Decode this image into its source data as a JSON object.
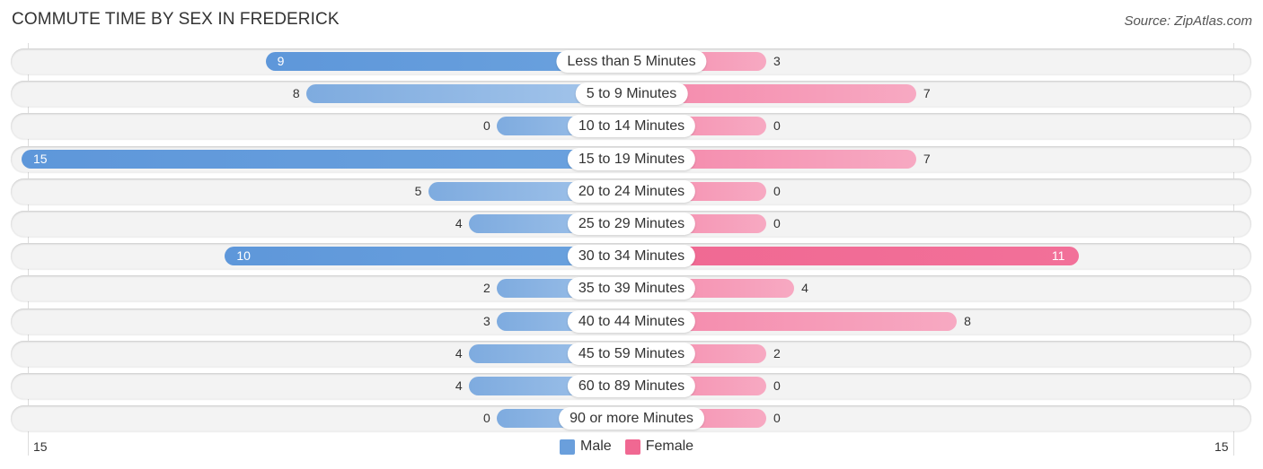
{
  "header": {
    "title": "COMMUTE TIME BY SEX IN FREDERICK",
    "source": "Source: ZipAtlas.com"
  },
  "colors": {
    "male": "#6a9fdc",
    "female": "#f06892",
    "male_light": "#a8c8ec",
    "female_light": "#f7a9c2"
  },
  "chart_data": {
    "type": "bar",
    "orientation": "horizontal-diverging",
    "title": "COMMUTE TIME BY SEX IN FREDERICK",
    "categories": [
      "Less than 5 Minutes",
      "5 to 9 Minutes",
      "10 to 14 Minutes",
      "15 to 19 Minutes",
      "20 to 24 Minutes",
      "25 to 29 Minutes",
      "30 to 34 Minutes",
      "35 to 39 Minutes",
      "40 to 44 Minutes",
      "45 to 59 Minutes",
      "60 to 89 Minutes",
      "90 or more Minutes"
    ],
    "series": [
      {
        "name": "Male",
        "values": [
          9,
          8,
          0,
          15,
          5,
          4,
          10,
          2,
          3,
          4,
          4,
          0
        ]
      },
      {
        "name": "Female",
        "values": [
          3,
          7,
          0,
          7,
          0,
          0,
          11,
          4,
          8,
          2,
          0,
          0
        ]
      }
    ],
    "xlim": [
      -15,
      15
    ],
    "axis_ticks": {
      "left": "15",
      "right": "15"
    },
    "legend": {
      "position": "bottom-center",
      "entries": [
        "Male",
        "Female"
      ]
    }
  }
}
